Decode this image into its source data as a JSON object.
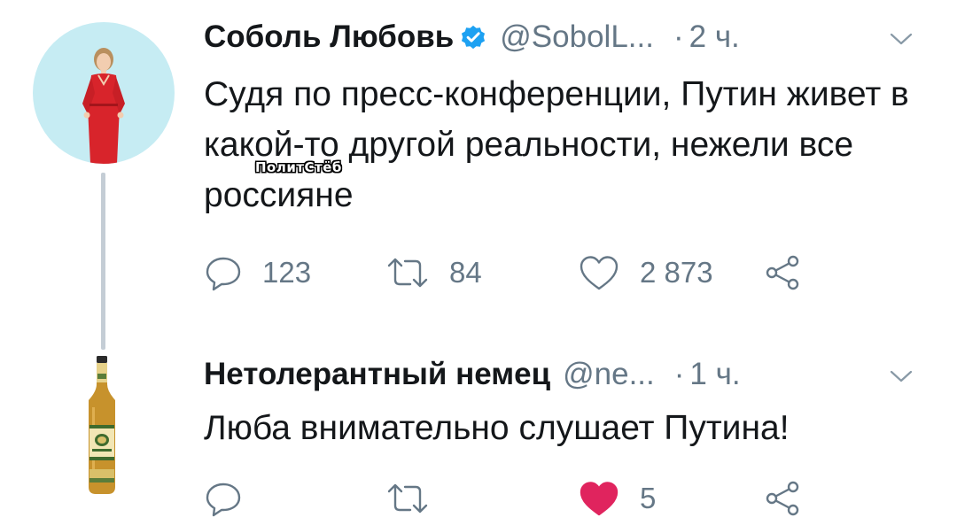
{
  "tweets": [
    {
      "author": {
        "name": "Соболь Любовь",
        "handle": "@SobolL...",
        "verified": true,
        "avatar": "woman-red-dress-avatar"
      },
      "dot": "·",
      "time": "2 ч.",
      "text": "Судя по пресс-конференции, Путин живет в какой-то другой реальности, нежели все россияне",
      "watermark": "ПолитСтёб",
      "actions": {
        "replies": "123",
        "retweets": "84",
        "likes": "2 873",
        "liked": false
      }
    },
    {
      "author": {
        "name": "Нетолерантный немец",
        "handle": "@ne...",
        "verified": false,
        "avatar": "beer-bottle-avatar"
      },
      "dot": "·",
      "time": "1 ч.",
      "text": "Люба внимательно слушает Путина!",
      "actions": {
        "replies": "",
        "retweets": "",
        "likes": "5",
        "liked": true
      }
    }
  ],
  "icons": {
    "reply": "speech-bubble-icon",
    "retweet": "retweet-arrows-icon",
    "like": "heart-icon",
    "share": "share-nodes-icon",
    "more": "chevron-down-icon",
    "verified": "verified-badge-icon"
  },
  "colors": {
    "text": "#14171a",
    "muted": "#657786",
    "verified": "#1da1f2",
    "like_active": "#e0245e",
    "thread_line": "#c4cdd5",
    "avatar_bg": "#c6ecf3",
    "dress": "#d8242b"
  }
}
